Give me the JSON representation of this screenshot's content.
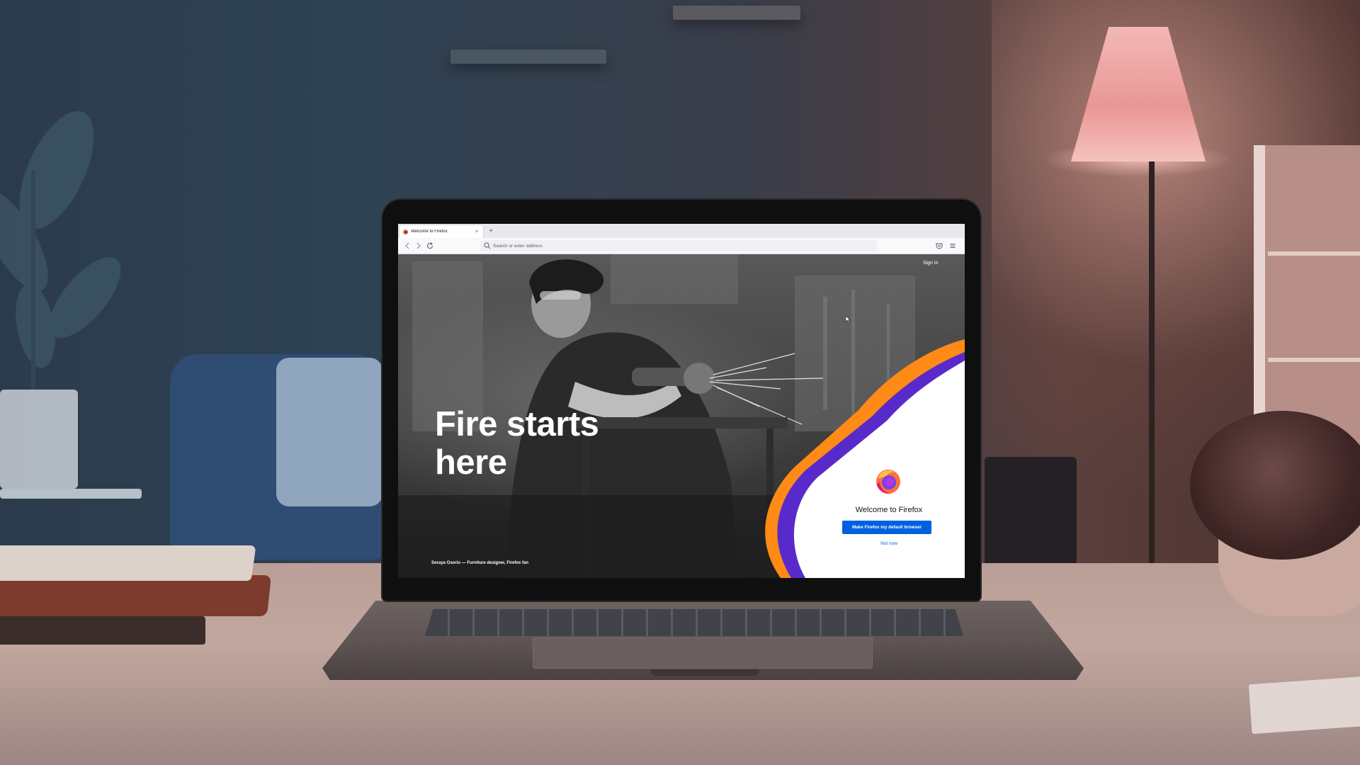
{
  "browser": {
    "tab": {
      "title": "Welcome to Firefox",
      "close_label": "×",
      "favicon": "firefox-logo-icon"
    },
    "new_tab_label": "+",
    "nav": {
      "back_icon": "arrow-left-icon",
      "forward_icon": "arrow-right-icon",
      "reload_icon": "reload-icon"
    },
    "urlbar": {
      "placeholder": "Search or enter address",
      "value": ""
    },
    "toolbar": {
      "pocket_icon": "pocket-icon",
      "menu_icon": "hamburger-menu-icon"
    }
  },
  "page": {
    "sign_in_label": "Sign in",
    "headline": "Fire starts here",
    "photo_caption": "Soraya Osorio — Furniture designer, Firefox fan",
    "welcome_title": "Welcome to Firefox",
    "primary_button_label": "Make Firefox my default browser",
    "secondary_link_label": "Not now"
  },
  "colors": {
    "primary_button": "#0061e0",
    "accent_orange": "#ff8a16",
    "accent_purple": "#592acb",
    "panel_background": "#ffffff"
  }
}
